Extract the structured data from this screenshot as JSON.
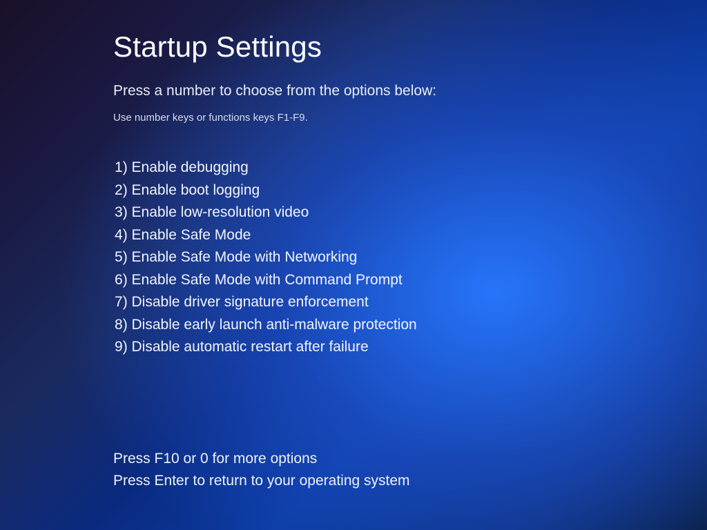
{
  "title": "Startup Settings",
  "subtitle": "Press a number to choose from the options below:",
  "hint": "Use number keys or functions keys F1-F9.",
  "options": [
    {
      "num": "1",
      "label": "Enable debugging"
    },
    {
      "num": "2",
      "label": "Enable boot logging"
    },
    {
      "num": "3",
      "label": "Enable low-resolution video"
    },
    {
      "num": "4",
      "label": "Enable Safe Mode"
    },
    {
      "num": "5",
      "label": "Enable Safe Mode with Networking"
    },
    {
      "num": "6",
      "label": "Enable Safe Mode with Command Prompt"
    },
    {
      "num": "7",
      "label": "Disable driver signature enforcement"
    },
    {
      "num": "8",
      "label": "Disable early launch anti-malware protection"
    },
    {
      "num": "9",
      "label": "Disable automatic restart after failure"
    }
  ],
  "footer": {
    "more": "Press F10 or 0 for more options",
    "return": "Press Enter to return to your operating system"
  }
}
